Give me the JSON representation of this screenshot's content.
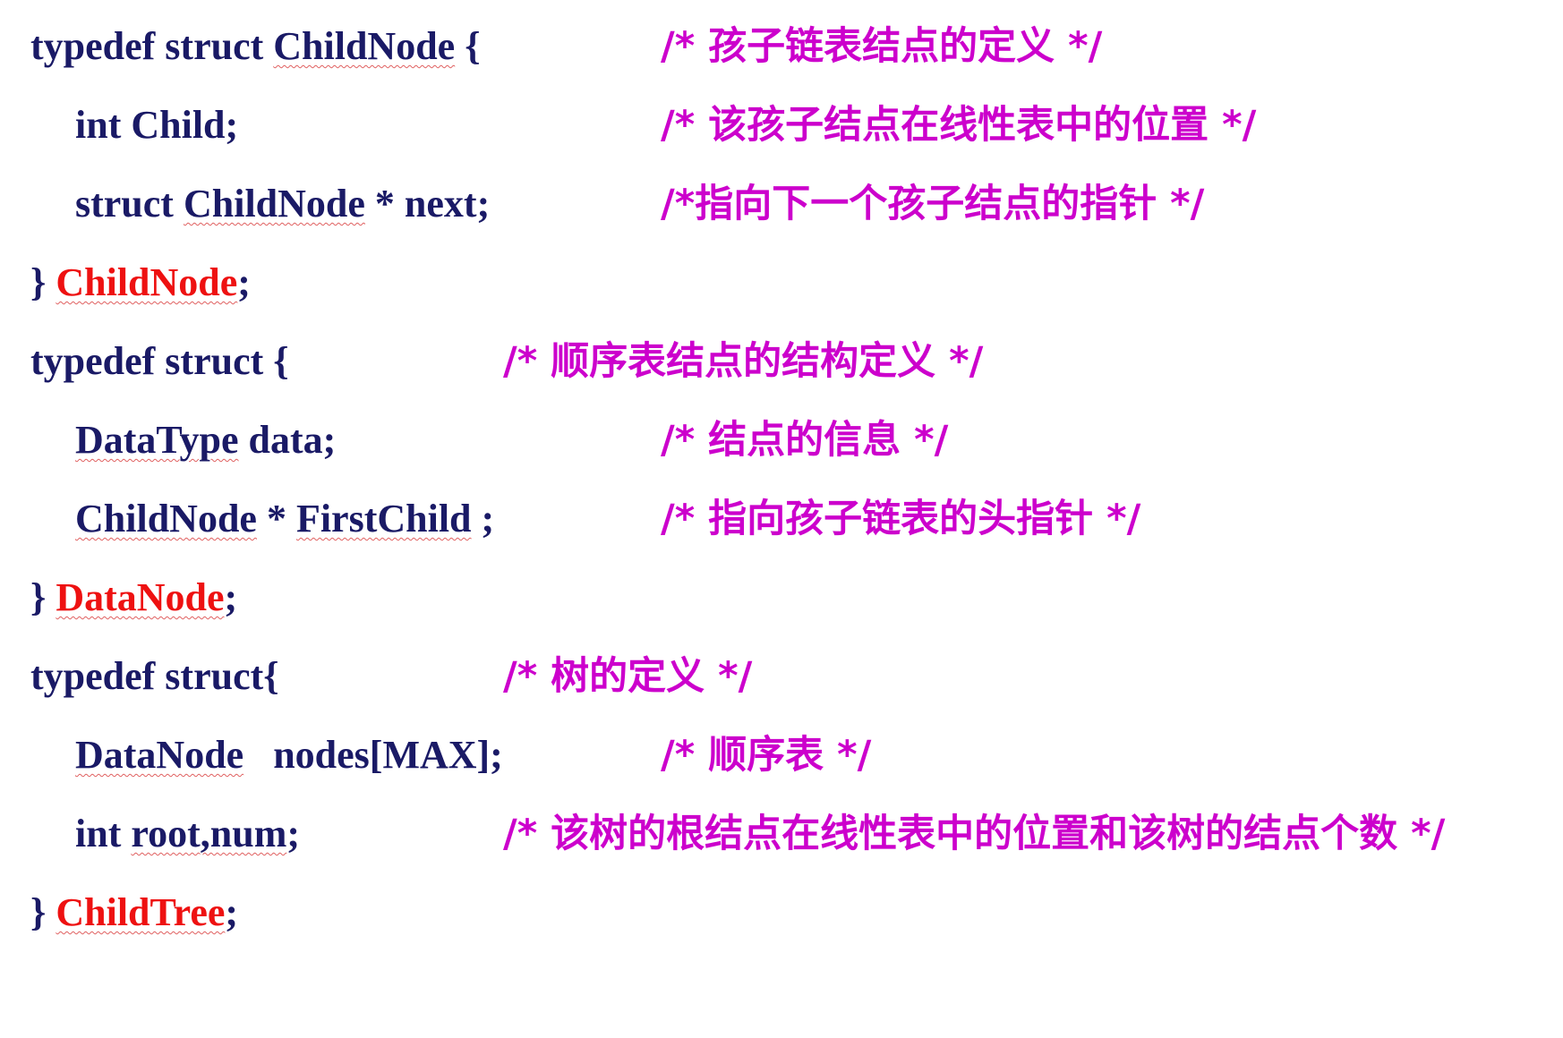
{
  "lines": [
    {
      "code_pre": "typedef struct ",
      "code_type": "ChildNode",
      "code_post": " {",
      "comment": "/* 孩子链表结点的定义 */"
    },
    {
      "code_pre": "int Child;",
      "comment": "/* 该孩子结点在线性表中的位置 */"
    },
    {
      "code_pre": "struct ",
      "code_type": "ChildNode",
      "code_post": " * next;",
      "comment": "/*指向下一个孩子结点的指针 */"
    },
    {
      "code_pre": "} ",
      "code_red": "ChildNode",
      "code_post": ";"
    },
    {
      "code_pre": "typedef struct {",
      "comment": "/* 顺序表结点的结构定义 */"
    },
    {
      "code_type": "DataType",
      "code_post": " data;",
      "comment": "/* 结点的信息 */"
    },
    {
      "code_type": "ChildNode",
      "code_mid": " * ",
      "code_type2": "FirstChild",
      "code_post": " ;",
      "comment": "/* 指向孩子链表的头指针 */"
    },
    {
      "code_pre": "} ",
      "code_red": "DataNode",
      "code_post": ";"
    },
    {
      "code_pre": "typedef struct{",
      "comment": "/* 树的定义 */"
    },
    {
      "code_type": "DataNode",
      "code_post": "   nodes[MAX];",
      "comment": "/* 顺序表 */"
    },
    {
      "code_pre": "int ",
      "code_type": "root,num",
      "code_post": ";",
      "comment": "/* 该树的根结点在线性表中的位置和该树的结点个数 */"
    },
    {
      "code_pre": "} ",
      "code_red": "ChildTree",
      "code_post": ";"
    }
  ],
  "colors": {
    "code": "#1a1a66",
    "comment": "#cc00cc",
    "typedef_name": "#ee1111"
  }
}
